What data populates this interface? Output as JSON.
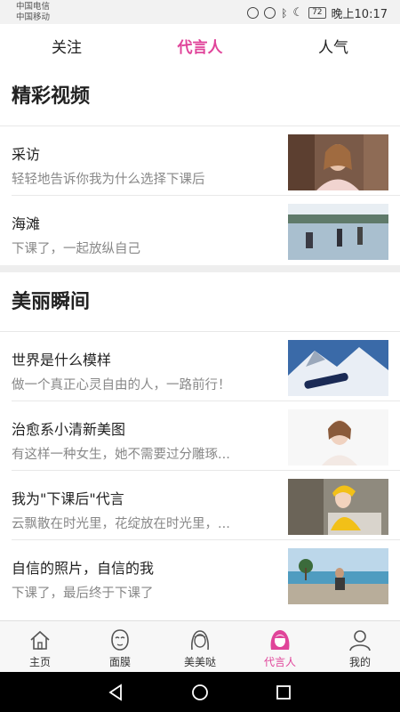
{
  "status_bar": {
    "carrier1": "中国电信",
    "carrier2": "中国移动",
    "battery": "72",
    "time": "晚上10:17"
  },
  "top_tabs": [
    {
      "label": "关注"
    },
    {
      "label": "代言人"
    },
    {
      "label": "人气"
    }
  ],
  "sections": [
    {
      "title": "精彩视频",
      "items": [
        {
          "title": "采访",
          "subtitle": "轻轻地告诉你我为什么选择下课后"
        },
        {
          "title": "海滩",
          "subtitle": "下课了，一起放纵自己"
        }
      ]
    },
    {
      "title": "美丽瞬间",
      "items": [
        {
          "title": "世界是什么模样",
          "subtitle": "做一个真正心灵自由的人，一路前行！"
        },
        {
          "title": "治愈系小清新美图",
          "subtitle": "有这样一种女生，她不需要过分雕琢..."
        },
        {
          "title": "我为\"下课后\"代言",
          "subtitle": "云飘散在时光里，花绽放在时光里，..."
        },
        {
          "title": "自信的照片，自信的我",
          "subtitle": "下课了，最后终于下课了"
        }
      ]
    }
  ],
  "bottom_nav": [
    {
      "label": "主页",
      "icon": "home-icon"
    },
    {
      "label": "面膜",
      "icon": "face-mask-icon"
    },
    {
      "label": "美美哒",
      "icon": "girl-face-icon"
    },
    {
      "label": "代言人",
      "icon": "spokesperson-icon"
    },
    {
      "label": "我的",
      "icon": "user-icon"
    }
  ],
  "colors": {
    "accent": "#e0449a"
  }
}
